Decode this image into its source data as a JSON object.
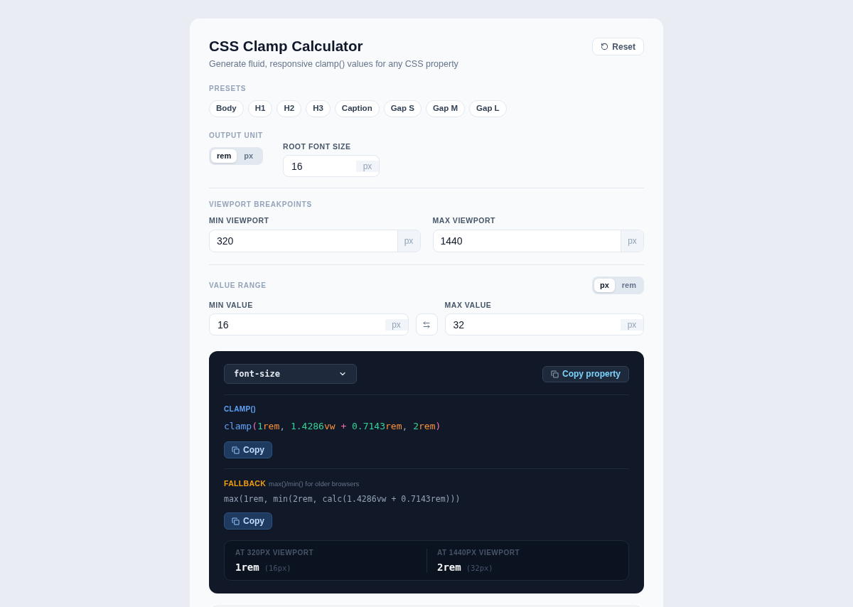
{
  "header": {
    "title": "CSS Clamp Calculator",
    "subtitle": "Generate fluid, responsive clamp() values for any CSS property",
    "reset_button": "Reset"
  },
  "presets": {
    "label": "PRESETS",
    "items": [
      "Body",
      "H1",
      "H2",
      "H3",
      "Caption",
      "Gap S",
      "Gap M",
      "Gap L"
    ]
  },
  "output_unit": {
    "label": "OUTPUT UNIT",
    "options": [
      {
        "label": "rem",
        "selected": true
      },
      {
        "label": "px",
        "selected": false
      }
    ]
  },
  "root_font_size": {
    "label": "ROOT FONT SIZE",
    "value": "16",
    "unit": "px"
  },
  "viewport_breakpoints": {
    "label": "VIEWPORT BREAKPOINTS",
    "fields": [
      {
        "label": "MIN VIEWPORT",
        "value": "320",
        "unit": "px"
      },
      {
        "label": "MAX VIEWPORT",
        "value": "1440",
        "unit": "px"
      }
    ]
  },
  "value_range": {
    "label": "VALUE RANGE",
    "unit_options": [
      {
        "label": "px",
        "selected": true
      },
      {
        "label": "rem",
        "selected": false
      }
    ],
    "fields": [
      {
        "label": "MIN VALUE",
        "value": "16",
        "unit": "px"
      },
      {
        "label": "MAX VALUE",
        "value": "32",
        "unit": "px"
      }
    ]
  },
  "output": {
    "property": "font-size",
    "copy_property_button": "Copy property",
    "clamp": {
      "label": "CLAMP()",
      "tokens": [
        {
          "kind": "function",
          "text": "clamp"
        },
        {
          "kind": "paren",
          "text": "("
        },
        {
          "kind": "number",
          "text": "1"
        },
        {
          "kind": "unit",
          "text": "rem"
        },
        {
          "kind": "punct",
          "text": ", "
        },
        {
          "kind": "number",
          "text": "1.4286"
        },
        {
          "kind": "unit",
          "text": "vw"
        },
        {
          "kind": "operator",
          "text": " + "
        },
        {
          "kind": "number",
          "text": "0.7143"
        },
        {
          "kind": "unit",
          "text": "rem"
        },
        {
          "kind": "punct",
          "text": ", "
        },
        {
          "kind": "number",
          "text": "2"
        },
        {
          "kind": "unit",
          "text": "rem"
        },
        {
          "kind": "paren",
          "text": ")"
        }
      ],
      "copy_button": "Copy"
    },
    "fallback": {
      "label": "FALLBACK",
      "note": "max()/min() for older browsers",
      "expression": "max(1rem, min(2rem, calc(1.4286vw + 0.7143rem)))",
      "copy_button": "Copy"
    },
    "stats": [
      {
        "label": "AT 320PX VIEWPORT",
        "value": "1rem",
        "px": "(16px)"
      },
      {
        "label": "AT 1440PX VIEWPORT",
        "value": "2rem",
        "px": "(32px)"
      }
    ]
  }
}
